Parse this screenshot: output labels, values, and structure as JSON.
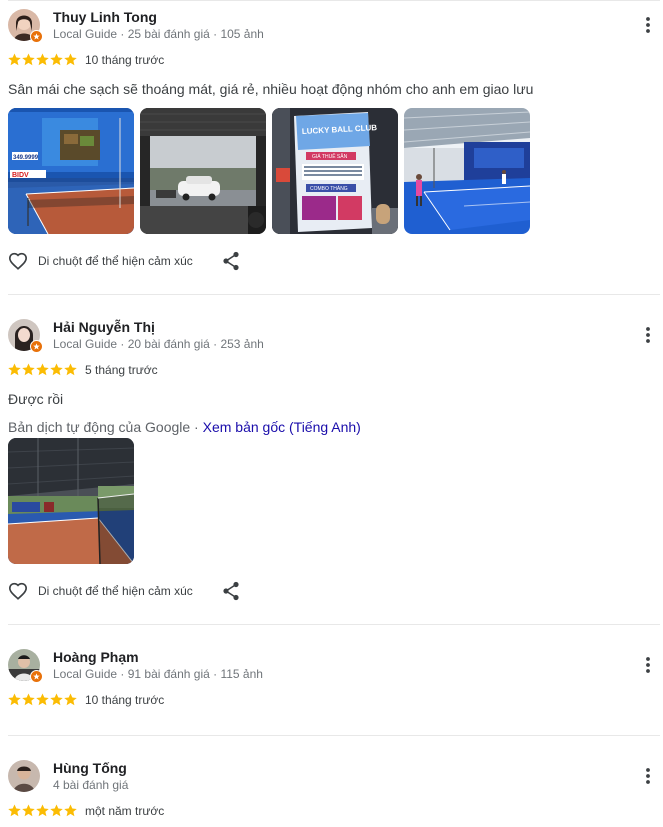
{
  "reviews": [
    {
      "name": "Thuy Linh Tong",
      "meta": "Local Guide · 25 bài đánh giá · 105 ảnh",
      "rating": 5,
      "when": "10 tháng trước",
      "text": "Sân mái che sạch sẽ thoáng mát, giá rẻ, nhiều hoạt động nhóm cho anh em giao lưu",
      "photos": 4,
      "photo_texts": {
        "banner_number": "349.9999",
        "poster_title": "LUCKY BALL CLUB",
        "poster_price": "GIÁ THUÊ SÂN",
        "poster_promo": "COMBO THÁNG"
      },
      "react_label": "Di chuột để thể hiện cảm xúc"
    },
    {
      "name": "Hải Nguyễn Thị",
      "meta": "Local Guide · 20 bài đánh giá · 253 ảnh",
      "rating": 5,
      "when": "5 tháng trước",
      "text": "Được rồi",
      "translation_prefix": "Bản dịch tự động của Google · ",
      "translation_link": "Xem bản gốc (Tiếng Anh)",
      "photos": 1,
      "react_label": "Di chuột để thể hiện cảm xúc"
    },
    {
      "name": "Hoàng Phạm",
      "meta": "Local Guide · 91 bài đánh giá · 115 ảnh",
      "rating": 5,
      "when": "10 tháng trước"
    },
    {
      "name": "Hùng Tống",
      "meta": "4 bài đánh giá",
      "rating": 5,
      "when": "một năm trước"
    }
  ],
  "colors": {
    "star": "#fbbc04",
    "badge": "#e8710a",
    "link": "#1a0dab",
    "divider": "#e8e8e8"
  },
  "icons": {
    "more": "more-vert-icon",
    "react": "heart-outline-icon",
    "share": "share-icon",
    "star": "star-icon",
    "badge": "local-guide-badge-icon"
  }
}
